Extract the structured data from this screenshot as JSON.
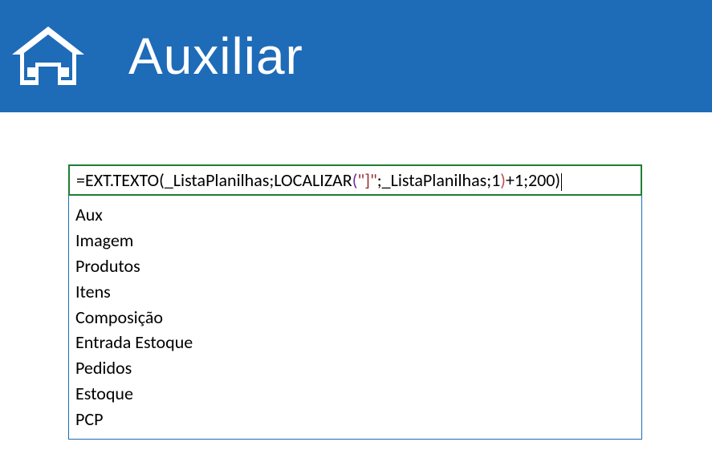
{
  "header": {
    "title": "Auxiliar"
  },
  "formula": {
    "prefix": "=",
    "fn_outer": "EXT.TEXTO",
    "paren_open1": "(",
    "arg1": "_ListaPlanilhas",
    "sep1": ";",
    "fn_inner": "LOCALIZAR",
    "paren_open2": "(",
    "str_literal": "\"]\"",
    "sep2": ";",
    "arg2": "_ListaPlanilhas",
    "sep3": ";",
    "num1": "1",
    "paren_close2": ")",
    "plus": "+",
    "num2": "1",
    "sep4": ";",
    "num3": "200",
    "paren_close1": ")"
  },
  "list": {
    "items": [
      "Aux",
      "Imagem",
      "Produtos",
      "Itens",
      "Composição",
      "Entrada Estoque",
      "Pedidos",
      "Estoque",
      "PCP"
    ]
  }
}
